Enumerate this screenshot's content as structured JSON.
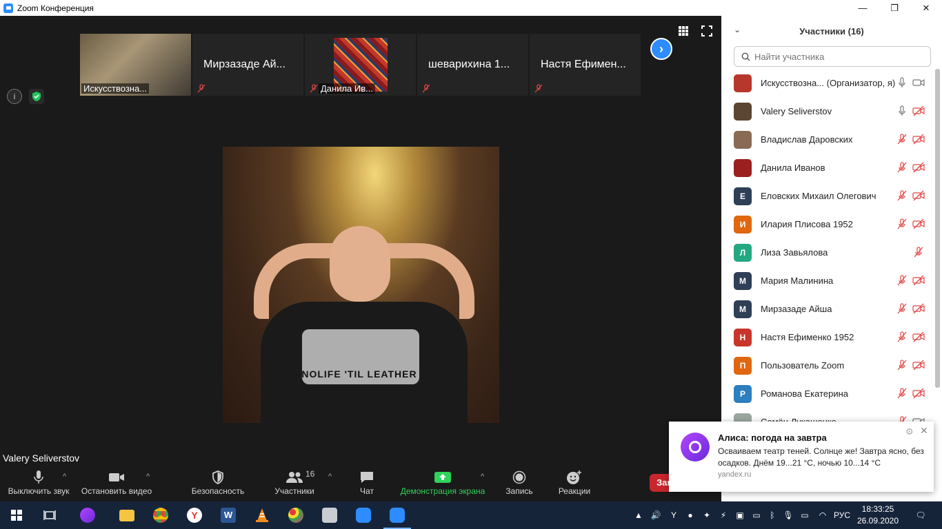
{
  "window": {
    "title": "Zoom Конференция",
    "minimize": "—",
    "maximize": "❐",
    "close": "✕"
  },
  "strip": {
    "tiles": [
      {
        "kind": "video",
        "label": "Искусствозна..."
      },
      {
        "kind": "name",
        "label": "Мирзазаде Ай..."
      },
      {
        "kind": "image",
        "label": "Данила Ив..."
      },
      {
        "kind": "name",
        "label": "шеварихина 1..."
      },
      {
        "kind": "name",
        "label": "Настя Ефимен..."
      }
    ]
  },
  "main": {
    "speaker": "Valery Seliverstov",
    "shirt_text": "NOLIFE 'TIL LEATHER"
  },
  "toolbar": {
    "mute_label": "Выключить звук",
    "video_label": "Остановить видео",
    "security_label": "Безопасность",
    "participants_label": "Участники",
    "participants_count": "16",
    "chat_label": "Чат",
    "share_label": "Демонстрация экрана",
    "record_label": "Запись",
    "reactions_label": "Реакции",
    "end_label": "Завершить"
  },
  "panel": {
    "title": "Участники (16)",
    "search_placeholder": "Найти участника",
    "participants": [
      {
        "name": "Искусствозна... (Организатор, я)",
        "initial": "",
        "color": "#b8372c",
        "mic": "on",
        "cam": "on"
      },
      {
        "name": "Valery Seliverstov",
        "initial": "",
        "color": "#5a4632",
        "mic": "on",
        "cam": "off"
      },
      {
        "name": "Владислав Даровских",
        "initial": "",
        "color": "#8a6a55",
        "mic": "off",
        "cam": "off"
      },
      {
        "name": "Данила Иванов",
        "initial": "",
        "color": "#9b1f1f",
        "mic": "off",
        "cam": "off"
      },
      {
        "name": "Еловских Михаил Олегович",
        "initial": "Е",
        "color": "#2e3f56",
        "mic": "off",
        "cam": "off"
      },
      {
        "name": "Илария Плисова 1952",
        "initial": "И",
        "color": "#e0660f",
        "mic": "off",
        "cam": "off"
      },
      {
        "name": "Лиза Завьялова",
        "initial": "Л",
        "color": "#23a882",
        "mic": "off",
        "cam": "none"
      },
      {
        "name": "Мария Малинина",
        "initial": "М",
        "color": "#2e3f56",
        "mic": "off",
        "cam": "off"
      },
      {
        "name": "Мирзазаде Айша",
        "initial": "М",
        "color": "#2e3f56",
        "mic": "off",
        "cam": "off"
      },
      {
        "name": "Настя Ефименко 1952",
        "initial": "Н",
        "color": "#c9352b",
        "mic": "off",
        "cam": "off"
      },
      {
        "name": "Пользователь Zoom",
        "initial": "П",
        "color": "#e0660f",
        "mic": "off",
        "cam": "off"
      },
      {
        "name": "Романова Екатерина",
        "initial": "Р",
        "color": "#2d7fbf",
        "mic": "off",
        "cam": "off"
      },
      {
        "name": "Семён Лукашенко",
        "initial": "",
        "color": "#9aa7a0",
        "mic": "off",
        "cam": "on"
      }
    ]
  },
  "notification": {
    "title": "Алиса: погода на завтра",
    "body": "Осваиваем театр теней. Солнце же! Завтра ясно, без осадков. Днём 19...21 °C, ночью 10...14 °C",
    "source": "yandex.ru"
  },
  "taskbar": {
    "lang": "РУС",
    "time": "18:33:25",
    "date": "26.09.2020"
  }
}
